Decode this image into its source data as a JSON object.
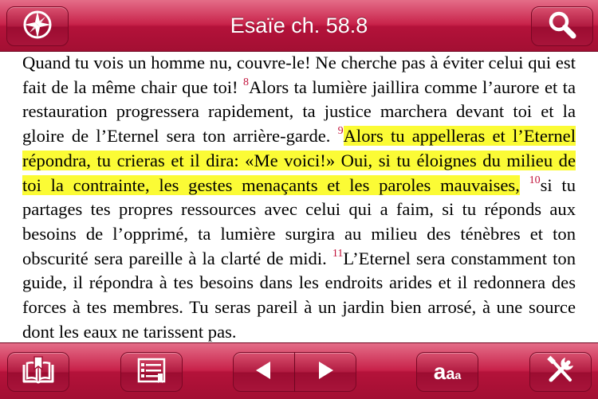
{
  "header": {
    "title": "Esaïe ch. 58.8",
    "left_icon": "compass-icon",
    "right_icon": "search-icon"
  },
  "passage": {
    "segments": [
      {
        "type": "text",
        "text": "Quand tu vois un homme nu, couvre-le! Ne cherche pas à éviter celui qui est fait de la même chair que toi! "
      },
      {
        "type": "verse",
        "text": "8"
      },
      {
        "type": "text",
        "text": "Alors ta lumière jaillira comme l’aurore et ta restauration progressera rapidement, ta justice marchera devant toi et la gloire de l’Eternel sera ton arrière-garde. "
      },
      {
        "type": "verse",
        "text": "9"
      },
      {
        "type": "highlight",
        "text": "Alors tu appelleras et l’Eternel répondra, tu crieras et il dira: «Me voici!» Oui, si tu éloignes du milieu de toi la contrainte, les gestes menaçants et les paroles mauvaises,"
      },
      {
        "type": "text",
        "text": " "
      },
      {
        "type": "verse",
        "text": "10"
      },
      {
        "type": "text",
        "text": "si tu partages tes propres ressources avec celui qui a faim, si tu réponds aux besoins de l’opprimé, ta lumière surgira au milieu des ténèbres et ton obscurité sera pareille à la clarté de midi. "
      },
      {
        "type": "verse",
        "text": "11"
      },
      {
        "type": "text",
        "text": "L’Eternel sera constamment ton guide, il répondra à tes besoins dans les endroits arides et il redonnera des forces à tes membres. Tu seras pareil à un jardin bien arrosé, à une source dont les eaux ne tarissent pas."
      }
    ],
    "highlight_color": "#fbfb35",
    "verse_number_color": "#c2143c"
  },
  "toolbar": {
    "bookmarks_icon": "book-bookmark-icon",
    "chapter_list_icon": "list-icon",
    "prev_icon": "previous-arrow-icon",
    "next_icon": "next-arrow-icon",
    "font_size_label": {
      "a1": "a",
      "a2": "a",
      "a3": "a"
    },
    "settings_icon": "tools-icon"
  },
  "colors": {
    "bar_red": "#b4123a",
    "bar_light": "#e46d88"
  }
}
